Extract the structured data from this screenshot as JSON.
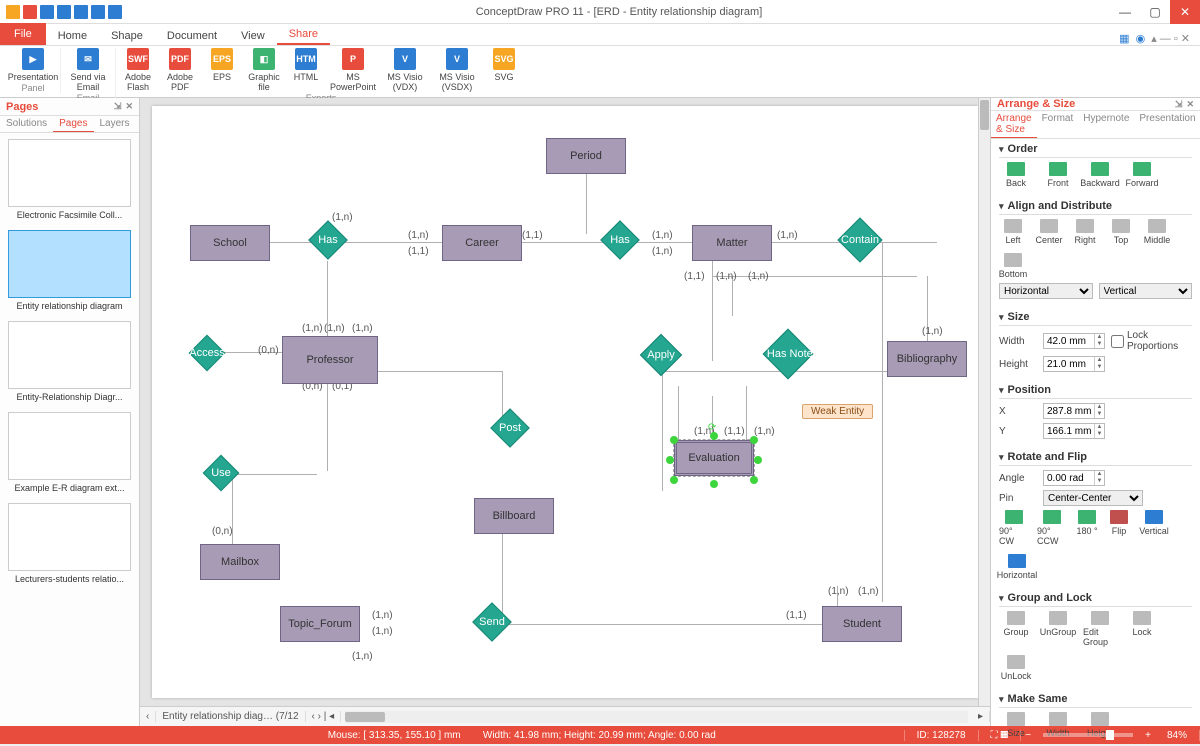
{
  "window_title": "ConceptDraw PRO 11 - [ERD - Entity relationship diagram]",
  "file_tab": "File",
  "menu_tabs": [
    "Home",
    "Shape",
    "Document",
    "View",
    "Share"
  ],
  "active_menu_tab": "Share",
  "ribbon": {
    "panel_group": {
      "items": [
        {
          "label": "Presentation",
          "color": "#2d7dd2"
        }
      ],
      "caption": "Panel"
    },
    "email_group": {
      "items": [
        {
          "label": "Send via Email",
          "color": "#2d7dd2"
        }
      ],
      "caption": "Email"
    },
    "exports_group": {
      "items": [
        {
          "label": "Adobe Flash",
          "color": "#e74c3c",
          "txt": "SWF"
        },
        {
          "label": "Adobe PDF",
          "color": "#e74c3c",
          "txt": "PDF"
        },
        {
          "label": "EPS",
          "color": "#f6a623",
          "txt": "EPS"
        },
        {
          "label": "Graphic file",
          "color": "#3cb371",
          "txt": ""
        },
        {
          "label": "HTML",
          "color": "#2d7dd2",
          "txt": "HTML"
        },
        {
          "label": "MS PowerPoint",
          "color": "#e74c3c",
          "txt": "P"
        },
        {
          "label": "MS Visio (VDX)",
          "color": "#2d7dd2",
          "txt": "V"
        },
        {
          "label": "MS Visio (VSDX)",
          "color": "#2d7dd2",
          "txt": "V"
        },
        {
          "label": "SVG",
          "color": "#f6a623",
          "txt": "SVG"
        }
      ],
      "caption": "Exports"
    }
  },
  "pages_panel": {
    "title": "Pages",
    "tabs": [
      "Solutions",
      "Pages",
      "Layers"
    ],
    "active_tab": "Pages",
    "thumbs": [
      {
        "label": "Electronic Facsimile Coll..."
      },
      {
        "label": "Entity relationship diagram",
        "selected": true
      },
      {
        "label": "Entity-Relationship Diagr..."
      },
      {
        "label": "Example E-R diagram ext..."
      },
      {
        "label": "Lecturers-students relatio..."
      }
    ]
  },
  "canvas": {
    "entities": {
      "period": "Period",
      "school": "School",
      "career": "Career",
      "matter": "Matter",
      "professor": "Professor",
      "bibliography": "Bibliography",
      "evaluation": "Evaluation",
      "billboard": "Billboard",
      "mailbox": "Mailbox",
      "topic": "Topic_Forum",
      "student": "Student"
    },
    "relations": {
      "has1": "Has",
      "has2": "Has",
      "contain": "Contain",
      "access": "Access",
      "apply": "Apply",
      "notes": "It Has Notes",
      "use": "Use",
      "post": "Post",
      "send": "Send"
    },
    "cards": {
      "c1": "(1,n)",
      "c11": "(1,1)",
      "c0n": "(0,n)",
      "c01": "(0,1)"
    },
    "weak_tooltip": "Weak Entity",
    "tab_label": "Entity relationship diag… (7/12"
  },
  "right_panel": {
    "title": "Arrange & Size",
    "tabs": [
      "Arrange & Size",
      "Format",
      "Hypernote",
      "Presentation"
    ],
    "active_tab": "Arrange & Size",
    "order": {
      "heading": "Order",
      "btns": [
        "Back",
        "Front",
        "Backward",
        "Forward"
      ]
    },
    "align": {
      "heading": "Align and Distribute",
      "row1": [
        "Left",
        "Center",
        "Right",
        "Top",
        "Middle",
        "Bottom"
      ],
      "h": "Horizontal",
      "v": "Vertical"
    },
    "size": {
      "heading": "Size",
      "width_label": "Width",
      "width_val": "42.0 mm",
      "height_label": "Height",
      "height_val": "21.0 mm",
      "lock": "Lock Proportions"
    },
    "position": {
      "heading": "Position",
      "x_label": "X",
      "x_val": "287.8 mm",
      "y_label": "Y",
      "y_val": "166.1 mm"
    },
    "rotate": {
      "heading": "Rotate and Flip",
      "angle_label": "Angle",
      "angle_val": "0.00 rad",
      "pin_label": "Pin",
      "pin_val": "Center-Center",
      "btns": [
        "90° CW",
        "90° CCW",
        "180 °",
        "Flip",
        "Vertical",
        "Horizontal"
      ]
    },
    "group": {
      "heading": "Group and Lock",
      "btns": [
        "Group",
        "UnGroup",
        "Edit Group",
        "Lock",
        "UnLock"
      ]
    },
    "make_same": {
      "heading": "Make Same",
      "btns": [
        "Size",
        "Width",
        "Height"
      ]
    }
  },
  "statusbar": {
    "mouse": "Mouse: [ 313.35, 155.10 ] mm",
    "dims": "Width: 41.98 mm;  Height: 20.99 mm;  Angle: 0.00 rad",
    "id": "ID: 128278",
    "zoom": "84%"
  }
}
